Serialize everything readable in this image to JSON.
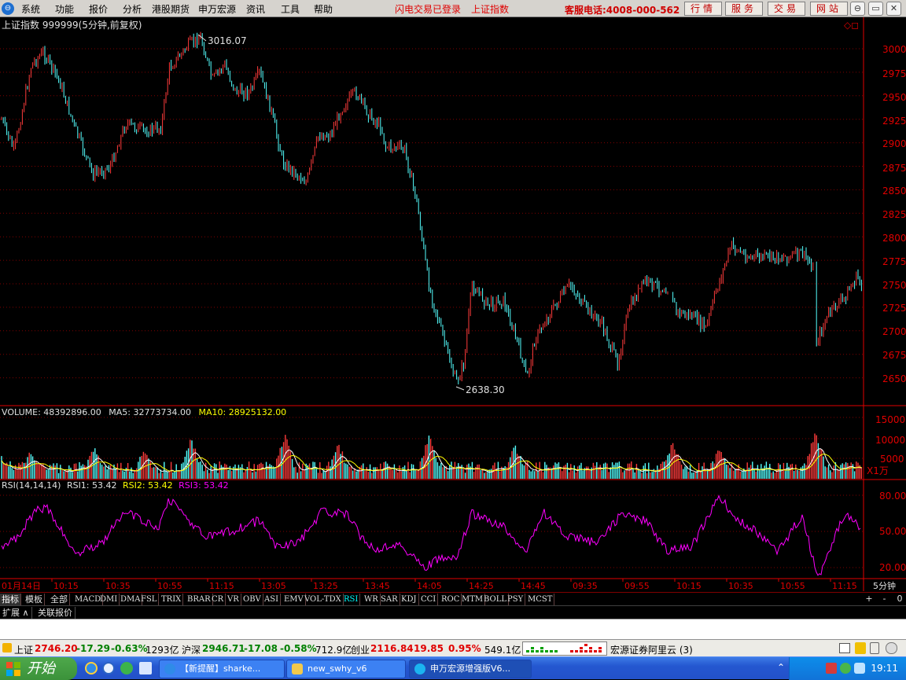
{
  "menubar": {
    "logo_glyph": "⊖",
    "items": [
      "系统",
      "功能",
      "报价",
      "分析",
      "港股期货",
      "申万宏源",
      "资讯",
      "工具",
      "帮助"
    ],
    "notice_login": "闪电交易已登录",
    "notice_index": "上证指数",
    "hotline": "客服电话:4008-000-562",
    "buttons": [
      "行情",
      "服务",
      "交易",
      "网站"
    ],
    "window_buttons": [
      "⊖",
      "▭",
      "✕"
    ]
  },
  "chart": {
    "header": "上证指数 999999(5分钟,前复权)",
    "corner_icons": "◇◻",
    "high_label": "3016.07",
    "low_label": "2638.30",
    "price_ticks": [
      "3000",
      "2975",
      "2950",
      "2925",
      "2900",
      "2875",
      "2850",
      "2825",
      "2800",
      "2775",
      "2750",
      "2725",
      "2700",
      "2675",
      "2650"
    ],
    "volume_header": {
      "label": "VOLUME:",
      "value": "48392896.00",
      "ma5_label": "MA5:",
      "ma5": "32773734.00",
      "ma10_label": "MA10:",
      "ma10": "28925132.00"
    },
    "volume_ticks": [
      "15000",
      "10000",
      "5000"
    ],
    "volume_unit": "X1万",
    "rsi_header": {
      "label": "RSI(14,14,14)",
      "rsi1_label": "RSI1:",
      "rsi1": "53.42",
      "rsi2_label": "RSI2:",
      "rsi2": "53.42",
      "rsi3_label": "RSI3:",
      "rsi3": "53.42"
    },
    "rsi_ticks": [
      "80.00",
      "50.00",
      "20.00"
    ],
    "time_labels": [
      "01月14日",
      "10:15",
      "10:35",
      "10:55",
      "11:15",
      "13:05",
      "13:25",
      "13:45",
      "14:05",
      "14:25",
      "14:45",
      "09:35",
      "09:55",
      "10:15",
      "10:35",
      "10:55",
      "11:15"
    ],
    "period": "5分钟",
    "colors": {
      "up": "#ff3b3b",
      "down": "#54ffff",
      "grid": "#800000",
      "axis": "#e00000",
      "ma5": "#ffffff",
      "ma10": "#ffff00",
      "rsi": "#ff00ff"
    }
  },
  "tabs": {
    "head": "指标",
    "items": [
      "模板",
      "全部",
      "MACD",
      "DMI",
      "DMA",
      "FSL",
      "TRIX",
      "BRAR",
      "CR",
      "VR",
      "OBV",
      "ASI",
      "EMV",
      "VOL-TDX",
      "RSI",
      "WR",
      "SAR",
      "KDJ",
      "CCI",
      "ROC",
      "MTM",
      "BOLL",
      "PSY",
      "MCST"
    ],
    "active": "RSI",
    "controls": [
      "+",
      "-",
      "0"
    ]
  },
  "subtabs": [
    "扩展 ∧",
    "关联报价"
  ],
  "status": {
    "sh_name": "上证",
    "sh_price": "2746.20",
    "sh_change": "-17.29",
    "sh_pct": "-0.63%",
    "sh_amount": "1293亿",
    "hs_name": "沪深",
    "hs_price": "2946.71",
    "hs_change": "-17.08",
    "hs_pct": "-0.58%",
    "hs_amount": "712.9亿",
    "cy_name": "创业",
    "cy_price": "2116.84",
    "cy_change": "19.85",
    "cy_pct": "0.95%",
    "cy_amount": "549.1亿",
    "broker": "宏源证券阿里云 (3)"
  },
  "taskbar": {
    "start": "开始",
    "tasks": [
      "【新提醒】sharke...",
      "new_swhy_v6",
      "申万宏源增强版V6..."
    ],
    "clock": "19:11"
  }
}
